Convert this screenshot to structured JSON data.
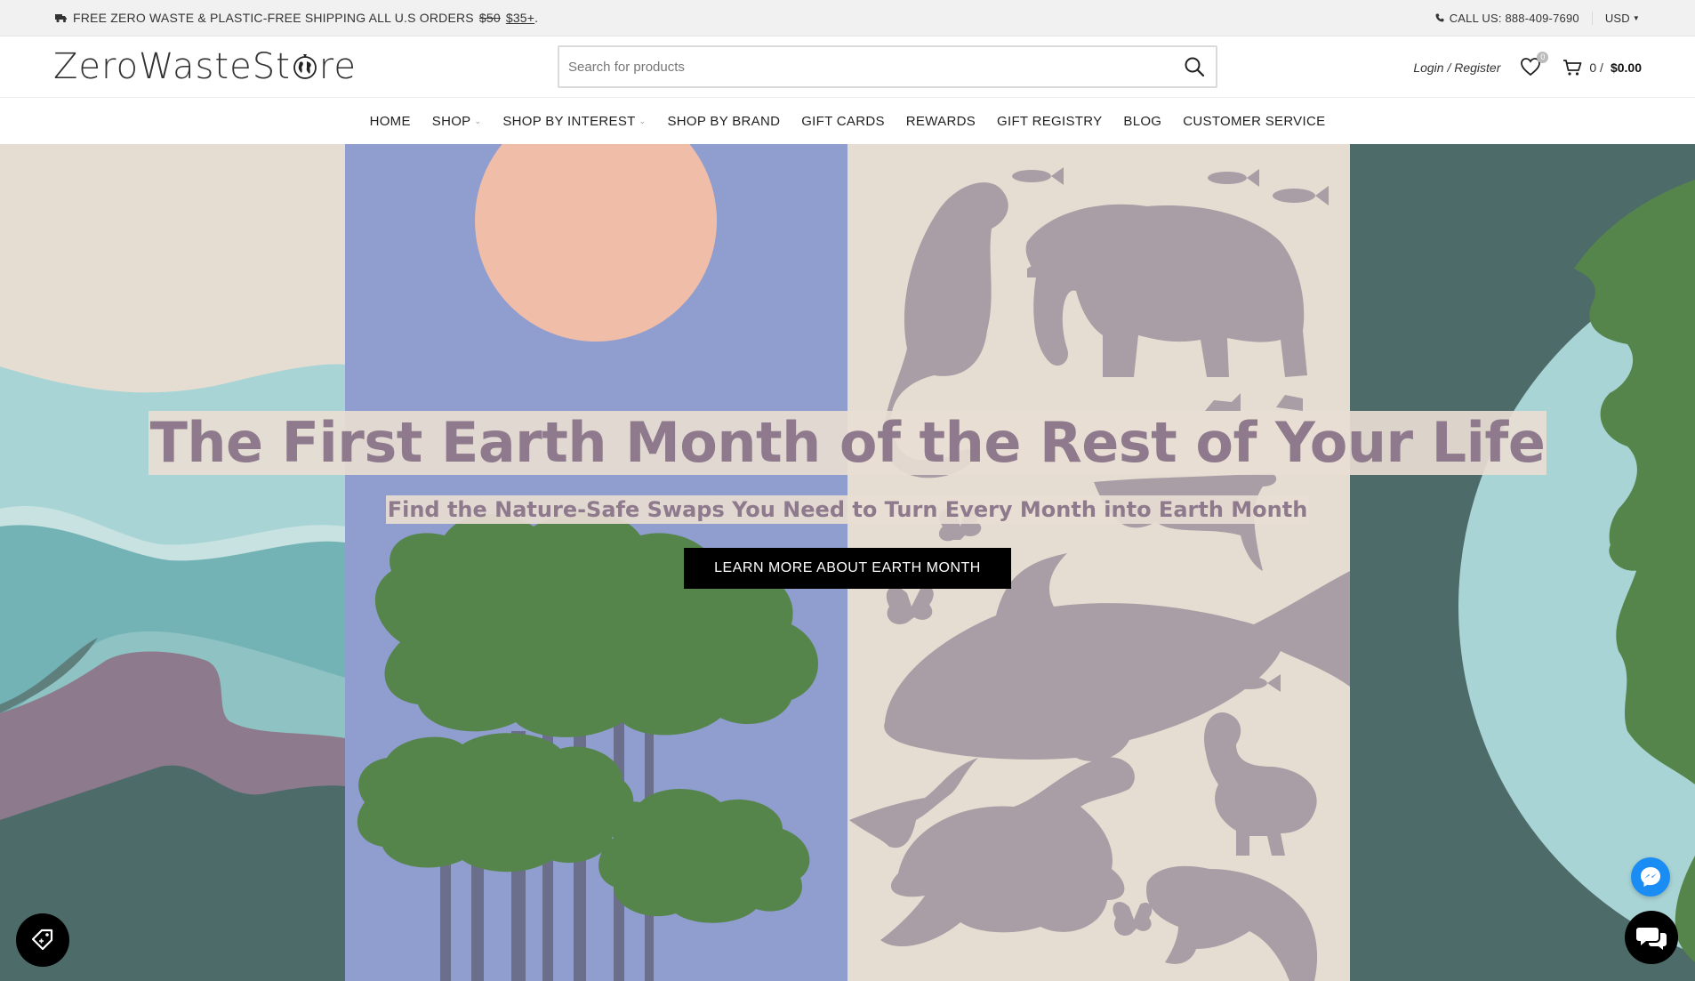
{
  "topbar": {
    "shipping_text": "FREE ZERO WASTE & PLASTIC-FREE SHIPPING ALL U.S ORDERS",
    "old_price": "$50",
    "new_price": "$35+",
    "suffix": ".",
    "call_text": "CALL US: 888-409-7690",
    "currency": "USD"
  },
  "header": {
    "logo_text_a": "ZeroWasteSt",
    "logo_text_b": "re",
    "search_placeholder": "Search for products",
    "login_label": "Login / Register",
    "wishlist_count": "0",
    "cart_count": "0 /",
    "cart_total": "$0.00"
  },
  "nav": {
    "items": [
      {
        "label": "HOME",
        "has_caret": false
      },
      {
        "label": "SHOP",
        "has_caret": true
      },
      {
        "label": "SHOP BY INTEREST",
        "has_caret": true
      },
      {
        "label": "SHOP BY BRAND",
        "has_caret": false
      },
      {
        "label": "GIFT CARDS",
        "has_caret": false
      },
      {
        "label": "REWARDS",
        "has_caret": false
      },
      {
        "label": "GIFT REGISTRY",
        "has_caret": false
      },
      {
        "label": "BLOG",
        "has_caret": false
      },
      {
        "label": "CUSTOMER SERVICE",
        "has_caret": false
      }
    ]
  },
  "hero": {
    "headline": "The First Earth Month of the Rest of Your Life",
    "subheadline": "Find the Nature-Safe Swaps You Need to Turn Every Month into Earth Month",
    "cta_label": "LEARN MORE ABOUT EARTH MONTH"
  },
  "colors": {
    "beige": "#e6ddd2",
    "periwinkle": "#8f9dcf",
    "sun": "#f0bea8",
    "tree_green": "#56854c",
    "animal_mauve": "#a99ea5",
    "dark_teal": "#4d6b69",
    "light_teal": "#8ec7c7",
    "headline_mauve": "#8e7a8c"
  },
  "icons": {
    "truck": "truck-icon",
    "phone": "phone-icon",
    "search": "search-icon",
    "heart": "heart-icon",
    "cart": "cart-icon",
    "tag": "tag-icon",
    "messenger": "messenger-icon",
    "chat": "chat-icon"
  }
}
